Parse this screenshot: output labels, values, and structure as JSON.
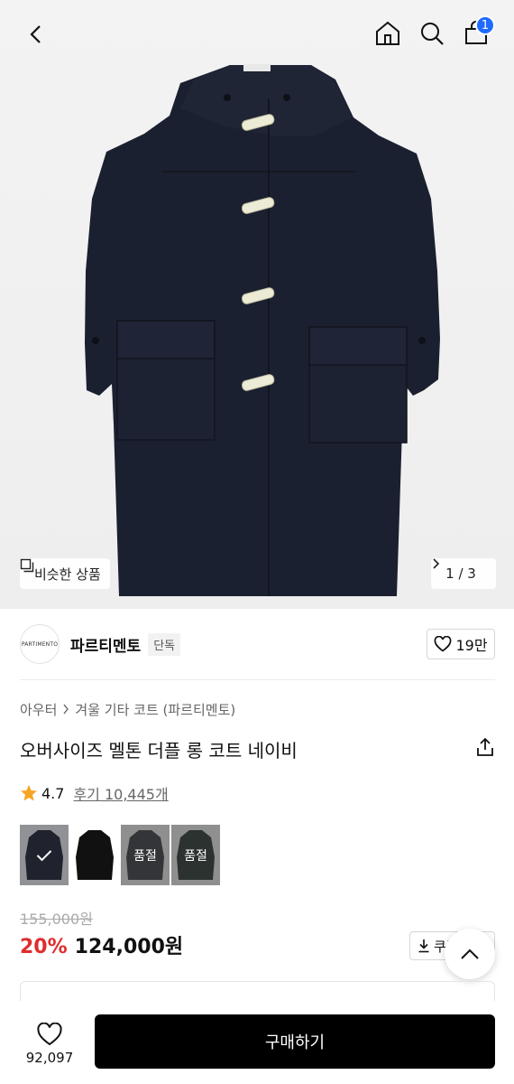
{
  "hero": {
    "similar_label": "비슷한 상품",
    "page_indicator": "1 / 3"
  },
  "header": {
    "cart_count": "1",
    "icons": [
      "back-icon",
      "home-icon",
      "search-icon",
      "cart-icon"
    ]
  },
  "brand": {
    "logo_text": "PARTIMENTO",
    "name": "파르티멘토",
    "tag": "단독",
    "likes": "19만"
  },
  "product": {
    "breadcrumb": [
      "아우터",
      "겨울 기타 코트 (파르티멘토)"
    ],
    "title": "오버사이즈 멜톤 더플 롱 코트 네이비",
    "rating": "4.7",
    "review_label": "후기 10,445개",
    "swatches": [
      {
        "color": "#1c2030",
        "label": "",
        "selected": true
      },
      {
        "color": "#111111",
        "label": "",
        "selected": false
      },
      {
        "color": "#2e3036",
        "label": "품절",
        "selected": false
      },
      {
        "color": "#1e2a26",
        "label": "품절",
        "selected": false
      }
    ],
    "original_price": "155,000원",
    "discount": "20%",
    "price": "124,000원",
    "coupon_label": "쿠폰"
  },
  "bottom": {
    "wish_count": "92,097",
    "buy_label": "구매하기"
  },
  "colors": {
    "accent": "#1f6bff",
    "discount": "#e02d2d",
    "coat": "#1b2030"
  }
}
